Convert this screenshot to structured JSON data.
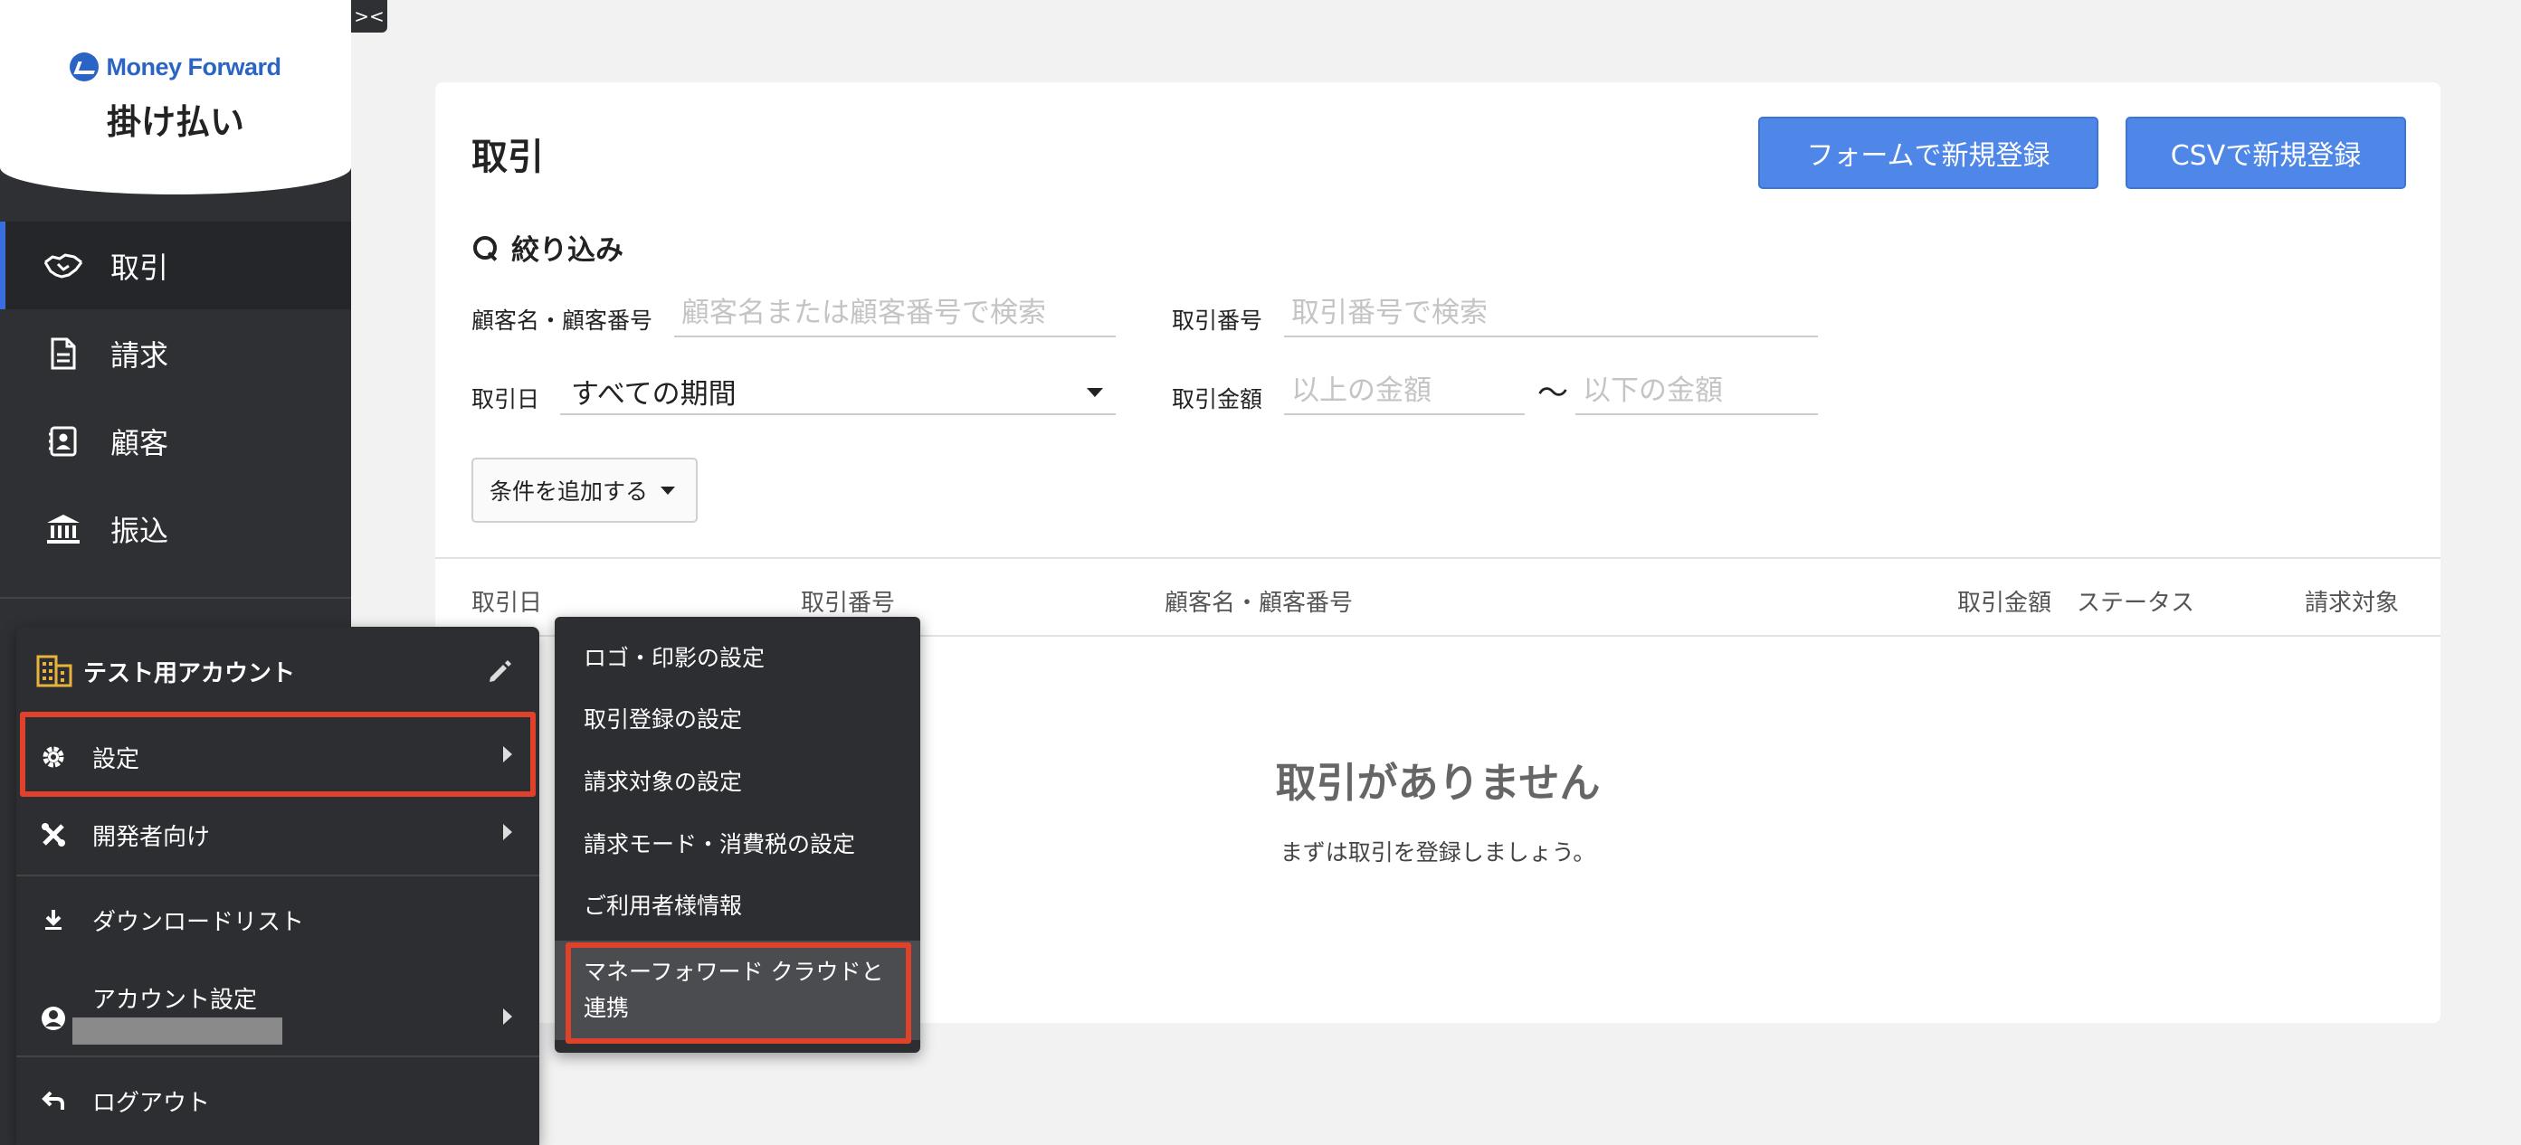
{
  "app": {
    "brand": "Money Forward",
    "product": "掛け払い"
  },
  "sidebar": {
    "collapse_label": "><",
    "items": [
      {
        "label": "取引",
        "icon": "handshake-icon",
        "active": true
      },
      {
        "label": "請求",
        "icon": "document-icon",
        "active": false
      },
      {
        "label": "顧客",
        "icon": "contact-card-icon",
        "active": false
      },
      {
        "label": "振込",
        "icon": "bank-icon",
        "active": false
      }
    ]
  },
  "account_menu": {
    "account_name": "テスト用アカウント",
    "items": [
      {
        "label": "設定",
        "icon": "gear-icon"
      },
      {
        "label": "開発者向け",
        "icon": "tools-icon"
      },
      {
        "label": "ダウンロードリスト",
        "icon": "download-icon"
      },
      {
        "label": "アカウント設定",
        "icon": "user-circle-icon"
      },
      {
        "label": "ログアウト",
        "icon": "logout-icon"
      }
    ]
  },
  "settings_submenu": {
    "items": [
      "ロゴ・印影の設定",
      "取引登録の設定",
      "請求対象の設定",
      "請求モード・消費税の設定",
      "ご利用者様情報"
    ],
    "selected_line1": "マネーフォワード クラウドと",
    "selected_line2": "連携"
  },
  "main": {
    "title": "取引",
    "btn_form": "フォームで新規登録",
    "btn_csv": "CSVで新規登録",
    "filter_title": "絞り込み",
    "filters": {
      "customer_label": "顧客名・顧客番号",
      "customer_placeholder": "顧客名または顧客番号で検索",
      "txn_no_label": "取引番号",
      "txn_no_placeholder": "取引番号で検索",
      "date_label": "取引日",
      "date_value": "すべての期間",
      "amount_label": "取引金額",
      "amount_min_placeholder": "以上の金額",
      "amount_tilde": "〜",
      "amount_max_placeholder": "以下の金額",
      "add_condition": "条件を追加する"
    },
    "table_columns": [
      "取引日",
      "取引番号",
      "顧客名・顧客番号",
      "取引金額",
      "ステータス",
      "請求対象"
    ],
    "empty_title": "取引がありません",
    "empty_sub": "まずは取引を登録しましょう。"
  }
}
